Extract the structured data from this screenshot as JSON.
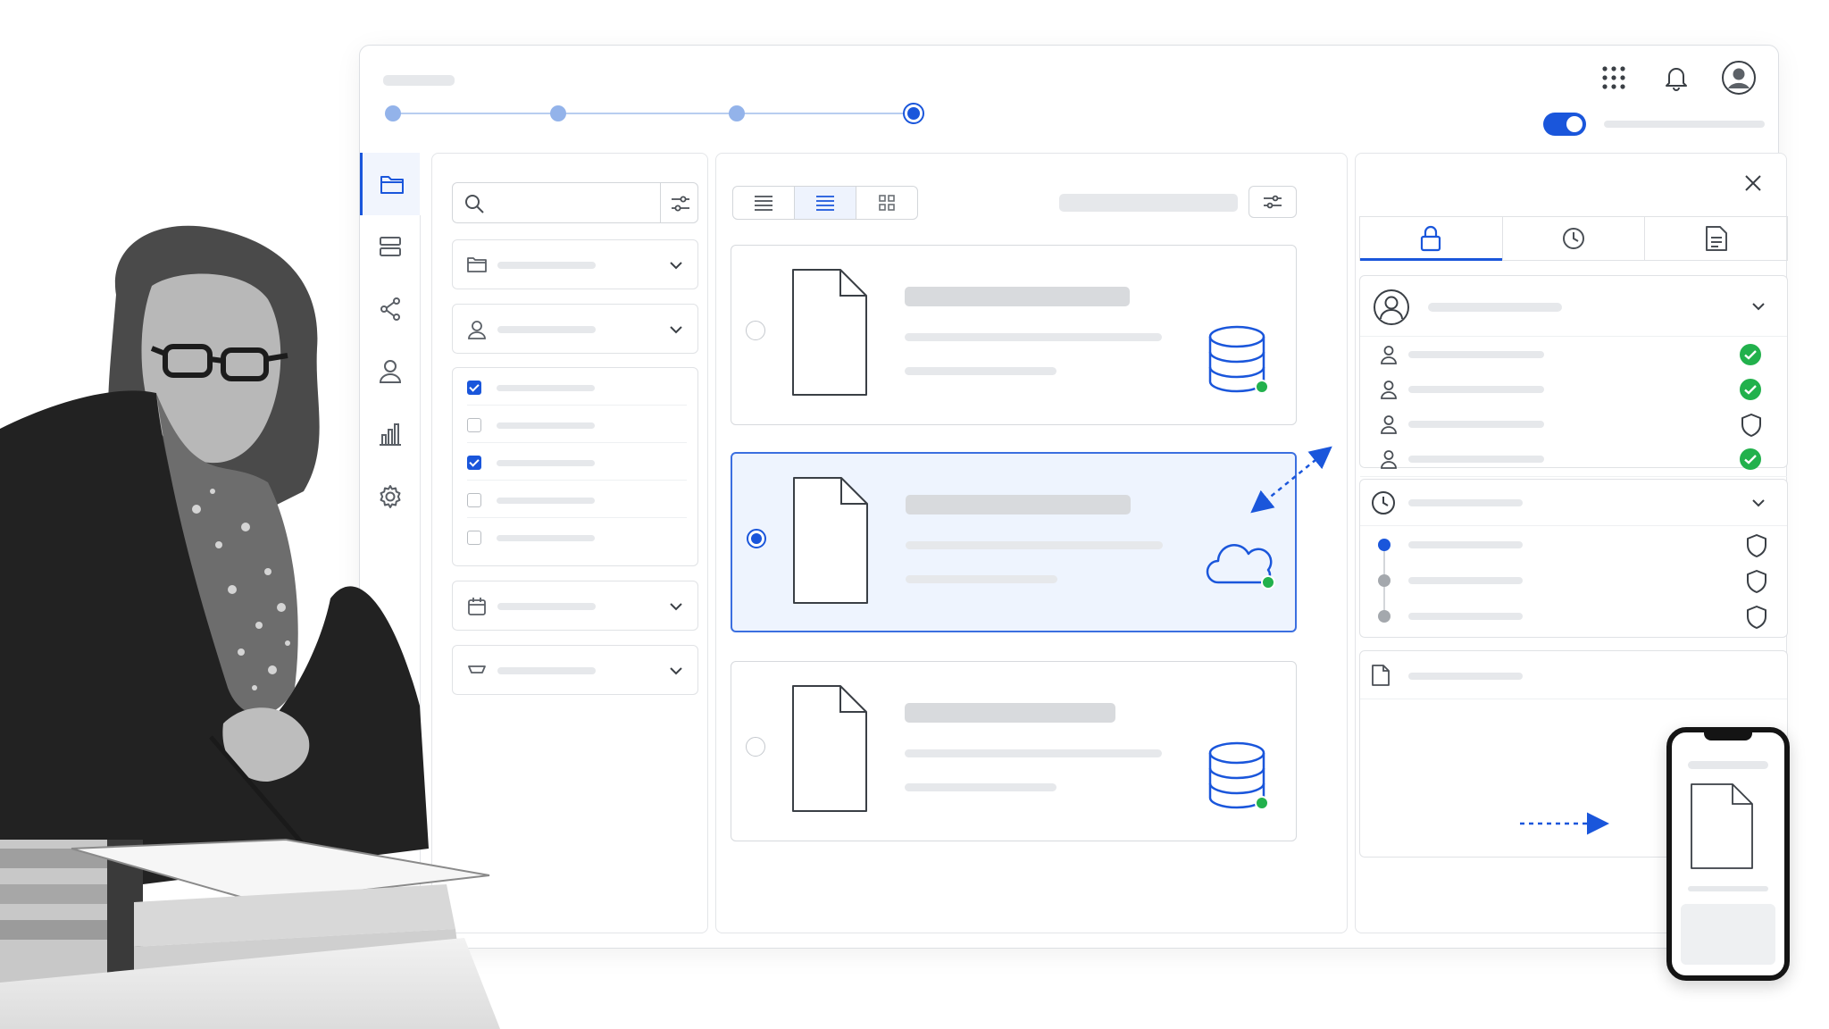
{
  "window": {
    "brand_accent": "#1a56db",
    "stepper": {
      "steps": 4,
      "current_step": 4
    },
    "top_icons": [
      "apps-grid-icon",
      "bell-icon",
      "user-avatar-icon"
    ],
    "sync_toggle_on": true
  },
  "nav": {
    "items": [
      {
        "icon": "folder-icon",
        "active": true
      },
      {
        "icon": "server-icon",
        "active": false
      },
      {
        "icon": "share-icon",
        "active": false
      },
      {
        "icon": "user-icon",
        "active": false
      },
      {
        "icon": "bar-chart-icon",
        "active": false
      },
      {
        "icon": "gear-icon",
        "active": false
      }
    ]
  },
  "filters": {
    "search_icon": "search-icon",
    "filter_icon": "sliders-icon",
    "dropdowns_top": [
      "folder-icon",
      "user-icon"
    ],
    "checklist": [
      true,
      false,
      true,
      false,
      false
    ],
    "dropdowns_bottom": [
      "calendar-icon",
      "tag-icon"
    ]
  },
  "documents": {
    "view_modes": [
      "list-compact-icon",
      "list-icon",
      "grid-icon"
    ],
    "active_view": 1,
    "cards": [
      {
        "selected": false,
        "storage": "database-icon",
        "status": "online",
        "status_color": "#22b14c"
      },
      {
        "selected": true,
        "storage": "cloud-icon",
        "status": "online",
        "status_color": "#22b14c"
      },
      {
        "selected": false,
        "storage": "database-icon",
        "status": "online",
        "status_color": "#22b14c"
      }
    ]
  },
  "details": {
    "tabs": [
      "lock-icon",
      "clock-icon",
      "document-icon"
    ],
    "active_tab": 0,
    "permissions": [
      {
        "icon": "user-icon",
        "status": "approved"
      },
      {
        "icon": "user-icon",
        "status": "approved"
      },
      {
        "icon": "user-icon",
        "status": "protected"
      },
      {
        "icon": "user-icon",
        "status": "approved"
      }
    ],
    "history": [
      {
        "current": true,
        "status": "protected"
      },
      {
        "current": false,
        "status": "protected"
      },
      {
        "current": false,
        "status": "protected"
      }
    ],
    "status_colors": {
      "approved": "#22b14c",
      "current": "#1a56db",
      "past": "#a4a8ad"
    }
  }
}
